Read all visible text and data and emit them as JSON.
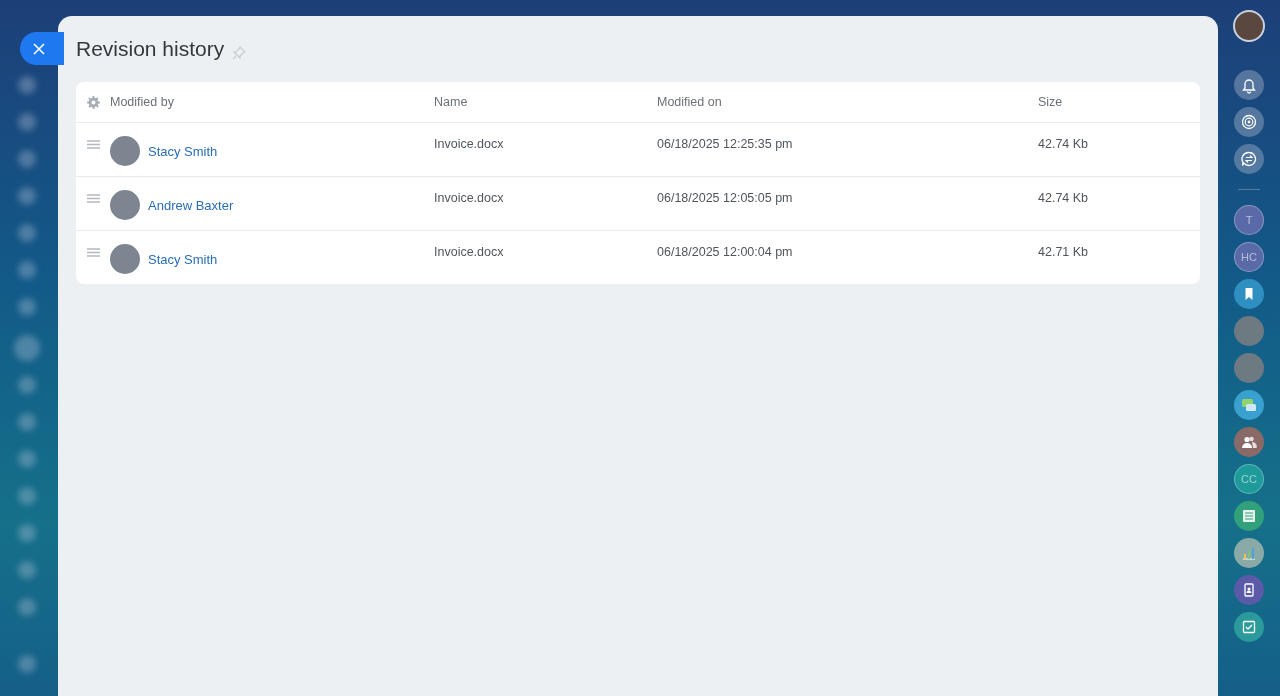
{
  "panel": {
    "title": "Revision history",
    "pinned": false
  },
  "table": {
    "columns": [
      "Modified by",
      "Name",
      "Modified on",
      "Size"
    ],
    "rows": [
      {
        "modified_by": "Stacy Smith",
        "name": "Invoice.docx",
        "modified_on": "06/18/2025 12:25:35 pm",
        "size": "42.74 Kb"
      },
      {
        "modified_by": "Andrew Baxter",
        "name": "Invoice.docx",
        "modified_on": "06/18/2025 12:05:05 pm",
        "size": "42.74 Kb"
      },
      {
        "modified_by": "Stacy Smith",
        "name": "Invoice.docx",
        "modified_on": "06/18/2025 12:00:04 pm",
        "size": "42.71 Kb"
      }
    ]
  },
  "right_sidebar": [
    {
      "kind": "avatar"
    },
    {
      "kind": "bell"
    },
    {
      "kind": "target"
    },
    {
      "kind": "chat-swap"
    },
    {
      "kind": "divider"
    },
    {
      "kind": "letters",
      "label": "T",
      "color": "#5a6aa8"
    },
    {
      "kind": "letters",
      "label": "HC",
      "color": "#5a6aa8"
    },
    {
      "kind": "bookmark",
      "color": "#2f8fc0"
    },
    {
      "kind": "avatar"
    },
    {
      "kind": "avatar"
    },
    {
      "kind": "chat",
      "color": "#3aa0d0"
    },
    {
      "kind": "people",
      "color": "#8a6a66"
    },
    {
      "kind": "letters",
      "label": "CC",
      "color": "#1e9a9a"
    },
    {
      "kind": "news",
      "color": "#32a07a"
    },
    {
      "kind": "chart",
      "color": "#8aaaa8"
    },
    {
      "kind": "contact",
      "color": "#5a5aa8"
    },
    {
      "kind": "check",
      "color": "#2a9a9a"
    }
  ]
}
